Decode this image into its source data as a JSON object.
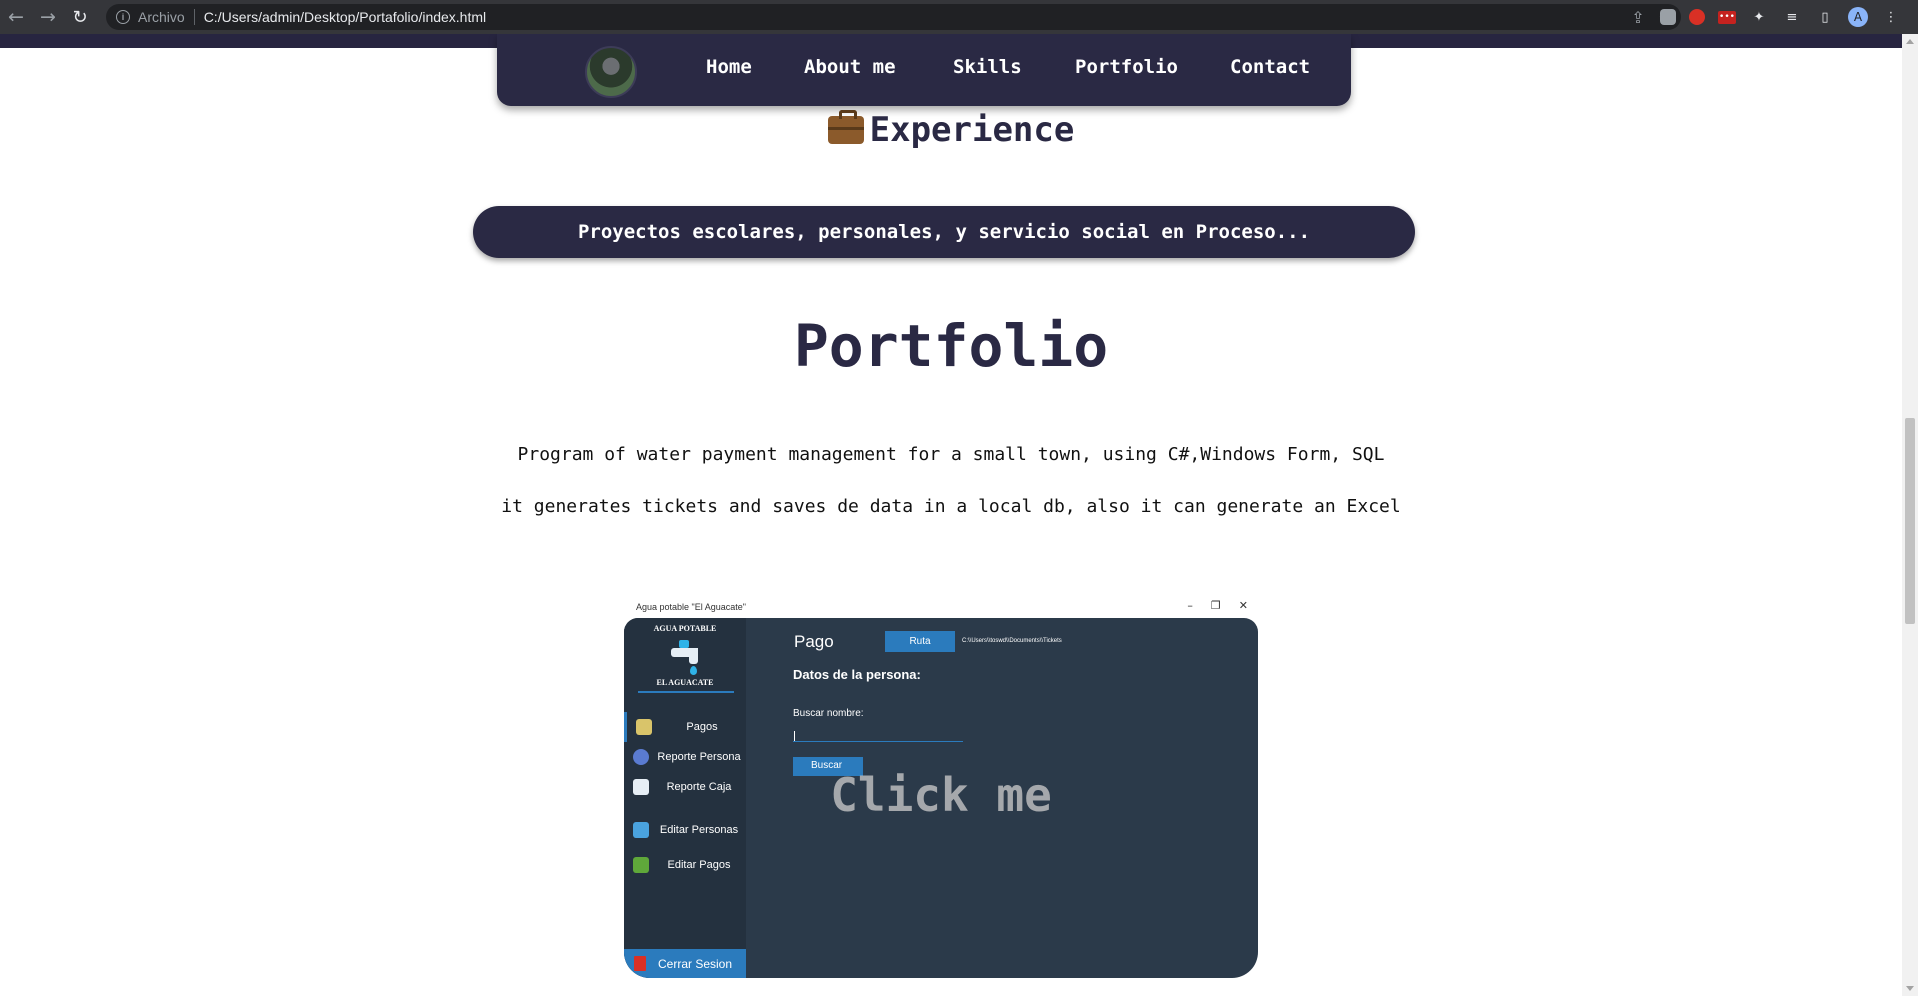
{
  "browser": {
    "scheme_label": "Archivo",
    "url": "C:/Users/admin/Desktop/Portafolio/index.html",
    "icons": [
      "back-arrow-icon",
      "forward-arrow-icon",
      "reload-icon",
      "info-icon",
      "share-icon",
      "star-icon",
      "extension-icon",
      "puzzle-icon",
      "reading-list-icon",
      "side-panel-icon",
      "profile-avatar-icon",
      "kebab-menu-icon"
    ],
    "avatar_letter": "A"
  },
  "nav": {
    "links": [
      "Home",
      "About me",
      "Skills",
      "Portfolio",
      "Contact"
    ]
  },
  "experience": {
    "title": "Experience",
    "project_banner": "Proyectos escolares, personales, y servicio social en Proceso..."
  },
  "portfolio": {
    "title": "Portfolio",
    "desc_line1": "Program of water payment management for a small town, using C#,Windows Form, SQL",
    "desc_line2": "it generates tickets and saves de data in a local db, also it can generate an Excel",
    "overlay_text": "Click me"
  },
  "app": {
    "window_title": "Agua potable \"El Aguacate\"",
    "window_controls": [
      "–",
      "❐",
      "✕"
    ],
    "logo_top": "AGUA POTABLE",
    "logo_bottom": "EL AGUACATE",
    "sidebar": [
      "Pagos",
      "Reporte Persona",
      "Reporte Caja",
      "Editar Personas",
      "Editar Pagos"
    ],
    "logout": "Cerrar Sesion",
    "heading": "Pago",
    "ruta_button": "Ruta",
    "ruta_path": "C:\\\\Users\\\\toswd\\\\Documents\\\\Tickets",
    "section_title": "Datos de la persona:",
    "search_label": "Buscar nombre:",
    "search_button": "Buscar"
  },
  "colors": {
    "navy": "#2a2944",
    "app_bg": "#2b3a4a",
    "app_accent": "#2b7bbd"
  }
}
